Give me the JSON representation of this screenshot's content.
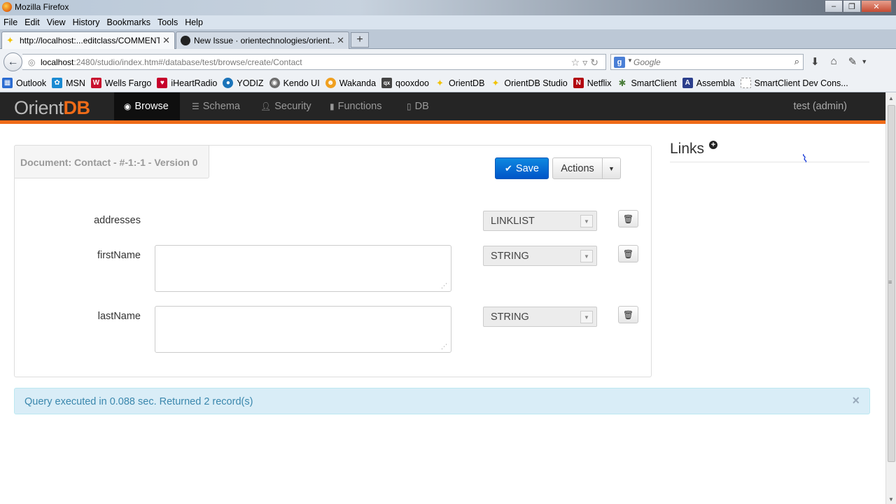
{
  "window": {
    "title": "Mozilla Firefox",
    "buttons": [
      "–",
      "❐",
      "✕"
    ]
  },
  "menubar": [
    "File",
    "Edit",
    "View",
    "History",
    "Bookmarks",
    "Tools",
    "Help"
  ],
  "tabs": [
    {
      "label": "http://localhost:...editclass/COMMENT",
      "close": "✕"
    },
    {
      "label": "New Issue · orientechnologies/orient...",
      "close": "✕"
    }
  ],
  "newtab": "+",
  "nav": {
    "url_host": "localhost",
    "url_rest": ":2480/studio/index.htm#/database/test/browse/create/Contact",
    "search_placeholder": "Google"
  },
  "bookmarks": [
    {
      "label": "Outlook",
      "color": "#2a6bd1",
      "glyph": "▦"
    },
    {
      "label": "MSN",
      "color": "#1a8ad2",
      "glyph": "✿"
    },
    {
      "label": "Wells Fargo",
      "color": "#c8102e",
      "glyph": "W"
    },
    {
      "label": "iHeartRadio",
      "color": "#c6002b",
      "glyph": "♥"
    },
    {
      "label": "YODIZ",
      "color": "#1a73b9",
      "glyph": "●"
    },
    {
      "label": "Kendo UI",
      "color": "#6d6d6d",
      "glyph": "◉"
    },
    {
      "label": "Wakanda",
      "color": "#f0a020",
      "glyph": "☻"
    },
    {
      "label": "qooxdoo",
      "color": "#444444",
      "glyph": "qx"
    },
    {
      "label": "OrientDB",
      "color": "#f2c200",
      "glyph": "✦"
    },
    {
      "label": "OrientDB Studio",
      "color": "#f2c200",
      "glyph": "✦"
    },
    {
      "label": "Netflix",
      "color": "#b20710",
      "glyph": "N"
    },
    {
      "label": "SmartClient",
      "color": "#4a7d3a",
      "glyph": "✱"
    },
    {
      "label": "Assembla",
      "color": "#2b3e8c",
      "glyph": "A"
    },
    {
      "label": "SmartClient Dev Cons...",
      "color": "#dddddd",
      "glyph": ""
    }
  ],
  "app": {
    "logo_a": "Orient",
    "logo_b": "DB",
    "nav": [
      {
        "label": "Browse",
        "icon": "eye-icon"
      },
      {
        "label": "Schema",
        "icon": "list-icon"
      },
      {
        "label": "Security",
        "icon": "user-icon"
      },
      {
        "label": "Functions",
        "icon": "bars-icon"
      },
      {
        "label": "DB",
        "icon": "book-icon"
      }
    ],
    "user": "test (admin)"
  },
  "document": {
    "header": "Document: Contact - #-1:-1 - Version 0",
    "save": "Save",
    "actions": "Actions",
    "fields": [
      {
        "name": "addresses",
        "type": "LINKLIST",
        "value": ""
      },
      {
        "name": "firstName",
        "type": "STRING",
        "value": ""
      },
      {
        "name": "lastName",
        "type": "STRING",
        "value": ""
      }
    ]
  },
  "links": {
    "title": "Links"
  },
  "alert": {
    "message": "Query executed in 0.088 sec. Returned 2 record(s)",
    "close": "×"
  }
}
